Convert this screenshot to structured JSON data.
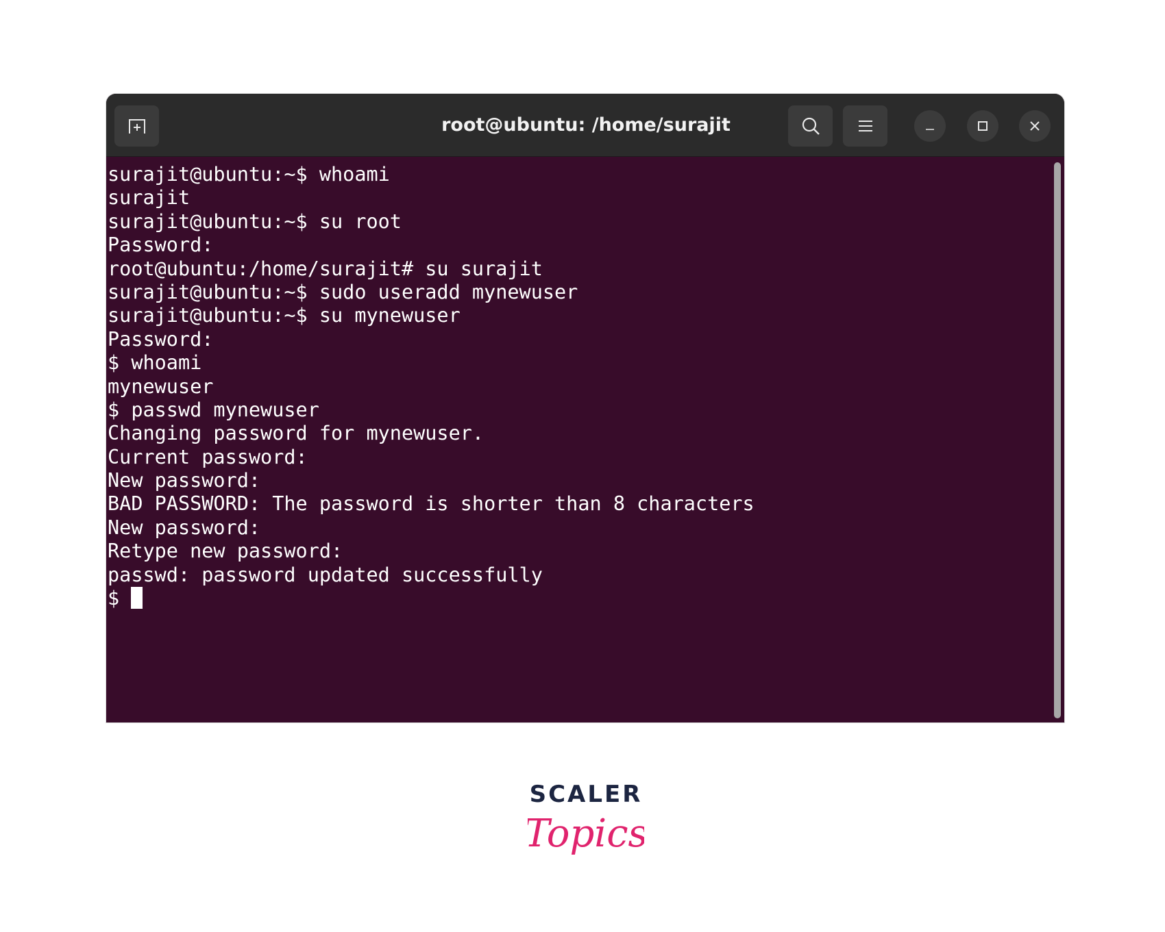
{
  "window": {
    "title": "root@ubuntu: /home/surajit"
  },
  "toolbar": {
    "new_tab_icon": "new-tab-icon",
    "search_icon": "search-icon",
    "menu_icon": "hamburger-menu-icon",
    "minimize_icon": "minimize-icon",
    "maximize_icon": "maximize-icon",
    "close_icon": "close-icon"
  },
  "terminal": {
    "background": "#380c2a",
    "foreground": "#ffffff",
    "lines": [
      "surajit@ubuntu:~$ whoami",
      "surajit",
      "surajit@ubuntu:~$ su root",
      "Password:",
      "root@ubuntu:/home/surajit# su surajit",
      "surajit@ubuntu:~$ sudo useradd mynewuser",
      "surajit@ubuntu:~$ su mynewuser",
      "Password:",
      "$ whoami",
      "mynewuser",
      "$ passwd mynewuser",
      "Changing password for mynewuser.",
      "Current password:",
      "New password:",
      "BAD PASSWORD: The password is shorter than 8 characters",
      "New password:",
      "Retype new password:",
      "passwd: password updated successfully"
    ],
    "prompt": "$ "
  },
  "logo": {
    "line1": "SCALER",
    "line2": "Topics",
    "color_dark": "#1c2541",
    "color_accent": "#e0236d"
  }
}
